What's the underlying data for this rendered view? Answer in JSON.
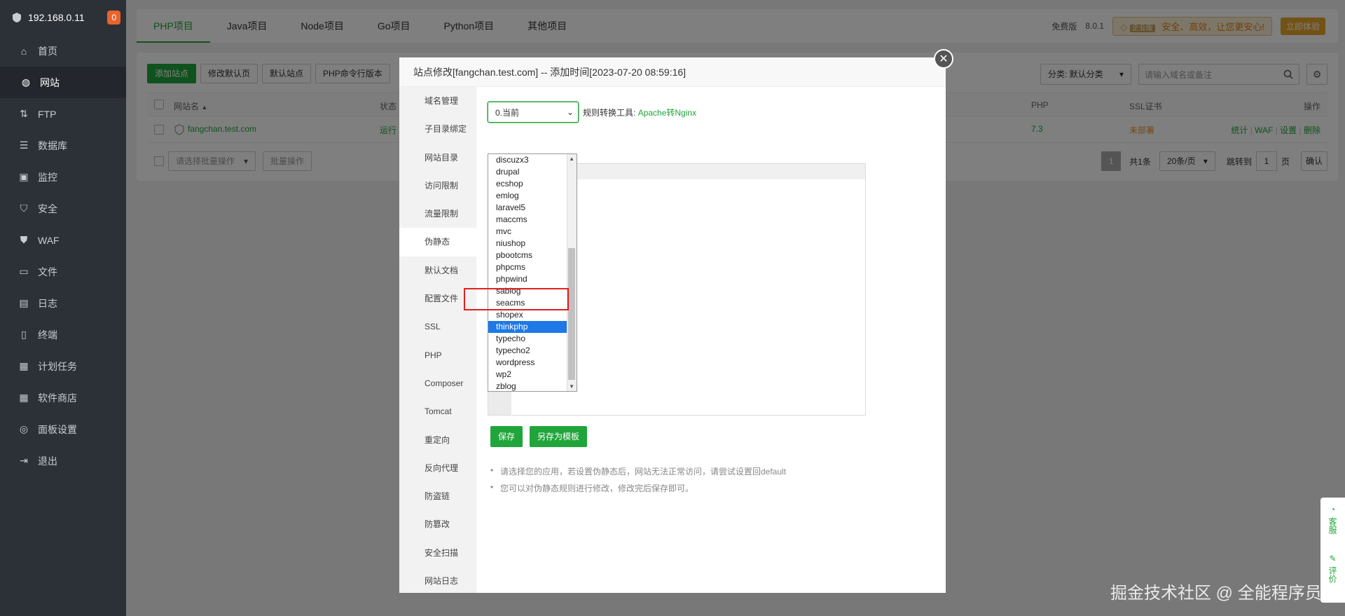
{
  "sidebar": {
    "ip": "192.168.0.11",
    "badge": "0",
    "items": [
      {
        "label": "首页",
        "icon": "home-icon"
      },
      {
        "label": "网站",
        "icon": "globe-icon",
        "active": true
      },
      {
        "label": "FTP",
        "icon": "ftp-icon"
      },
      {
        "label": "数据库",
        "icon": "database-icon"
      },
      {
        "label": "监控",
        "icon": "monitor-icon"
      },
      {
        "label": "安全",
        "icon": "shield-icon"
      },
      {
        "label": "WAF",
        "icon": "waf-icon"
      },
      {
        "label": "文件",
        "icon": "folder-icon"
      },
      {
        "label": "日志",
        "icon": "log-icon"
      },
      {
        "label": "终端",
        "icon": "terminal-icon"
      },
      {
        "label": "计划任务",
        "icon": "calendar-icon"
      },
      {
        "label": "软件商店",
        "icon": "apps-icon"
      },
      {
        "label": "面板设置",
        "icon": "settings-icon"
      },
      {
        "label": "退出",
        "icon": "logout-icon"
      }
    ]
  },
  "topbar": {
    "tabs": [
      "PHP项目",
      "Java项目",
      "Node项目",
      "Go项目",
      "Python项目",
      "其他项目"
    ],
    "edition": "免费版",
    "version": "8.0.1",
    "enterprise_badge": "企业版",
    "promo": "安全、高效，让您更安心!",
    "try_button": "立即体验"
  },
  "toolbar": {
    "buttons": [
      "添加站点",
      "修改默认页",
      "默认站点",
      "PHP命令行版本"
    ],
    "category": "分类: 默认分类",
    "search_placeholder": "请输入域名或备注"
  },
  "table": {
    "headers": {
      "name": "网站名",
      "status": "状态",
      "php": "PHP",
      "ssl": "SSL证书",
      "ops": "操作"
    },
    "row": {
      "name": "fangchan.test.com",
      "status": "运行",
      "php": "7.3",
      "ssl": "未部署",
      "ops": [
        "统计",
        "WAF",
        "设置",
        "删除"
      ]
    },
    "batch_placeholder": "请选择批量操作",
    "batch_button": "批量操作",
    "page": "1",
    "total": "共1条",
    "per_page": "20条/页",
    "jump_label": "跳转到",
    "jump_value": "1",
    "page_unit": "页",
    "confirm": "确认"
  },
  "modal": {
    "title": "站点修改[fangchan.test.com] -- 添加时间[2023-07-20 08:59:16]",
    "menu": [
      "域名管理",
      "子目录绑定",
      "网站目录",
      "访问限制",
      "流量限制",
      "伪静态",
      "默认文档",
      "配置文件",
      "SSL",
      "PHP",
      "Composer",
      "Tomcat",
      "重定向",
      "反向代理",
      "防盗链",
      "防篡改",
      "安全扫描",
      "网站日志"
    ],
    "active_menu": "伪静态",
    "select_value": "0.当前",
    "convert_label": "规则转换工具:",
    "convert_link": "Apache转Nginx",
    "options": [
      "discuzx3",
      "drupal",
      "ecshop",
      "emlog",
      "laravel5",
      "maccms",
      "mvc",
      "niushop",
      "pbootcms",
      "phpcms",
      "phpwind",
      "sablog",
      "seacms",
      "shopex",
      "thinkphp",
      "typecho",
      "typecho2",
      "wordpress",
      "wp2",
      "zblog"
    ],
    "selected_option": "thinkphp",
    "save_button": "保存",
    "save_template_button": "另存为模板",
    "tips": [
      "请选择您的应用，若设置伪静态后，网站无法正常访问，请尝试设置回default",
      "您可以对伪静态规则进行修改，修改完后保存即可。"
    ]
  },
  "float_help": {
    "service": "客服",
    "review": "评价"
  },
  "watermark": "掘金技术社区 @ 全能程序员"
}
